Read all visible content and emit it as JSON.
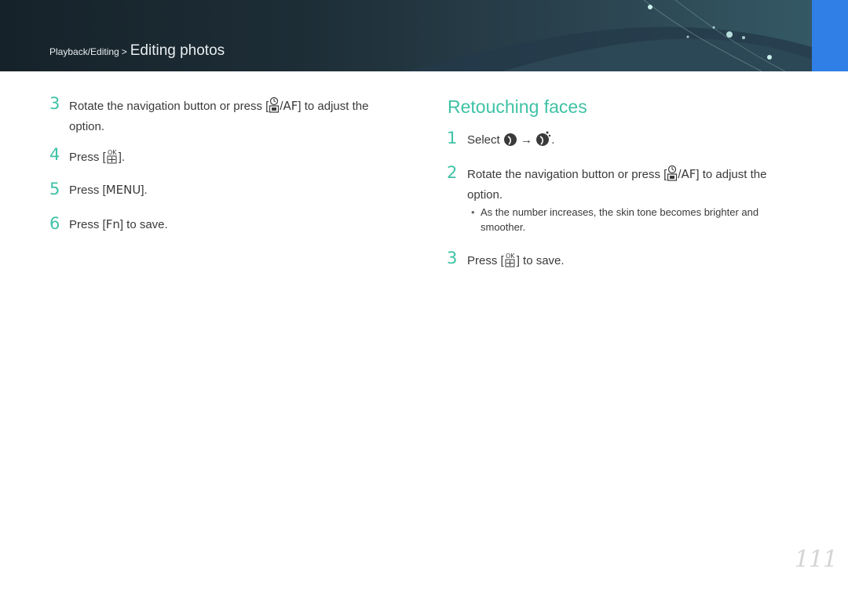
{
  "header": {
    "section": "Playback/Editing",
    "separator": ">",
    "title": "Editing photos"
  },
  "left_steps": [
    {
      "number": "3",
      "text_before": "Rotate the navigation button or press [",
      "key": "AF",
      "text_after": "] to adjust the",
      "text_line2": "option."
    },
    {
      "number": "4",
      "text_before": "Press [",
      "text_after": "]."
    },
    {
      "number": "5",
      "text_before": "Press [",
      "key": "MENU",
      "text_after": "]."
    },
    {
      "number": "6",
      "text_before": "Press [",
      "key": "Fn",
      "text_after": "] to save."
    }
  ],
  "retouching": {
    "heading": "Retouching faces",
    "steps": [
      {
        "number": "1",
        "text_before": "Select",
        "arrow": "→",
        "text_after": "."
      },
      {
        "number": "2",
        "text_before": "Rotate the navigation button or press [",
        "key": "AF",
        "text_after": "] to adjust the",
        "text_line2": "option."
      },
      {
        "number": "3",
        "text_before": "Press [",
        "text_after": "] to save."
      }
    ],
    "bullet": {
      "marker": "•",
      "text": "As the number increases, the skin tone becomes brighter and smoother."
    }
  },
  "page_number": "111",
  "colors": {
    "accent": "#3fc2a5",
    "banner_dark": "#16222a",
    "tab_blue": "#2f7fe6"
  },
  "icons": [
    "timer-icon",
    "ok-button-icon",
    "face-retouch-icon",
    "face-retouch-plus-icon"
  ]
}
